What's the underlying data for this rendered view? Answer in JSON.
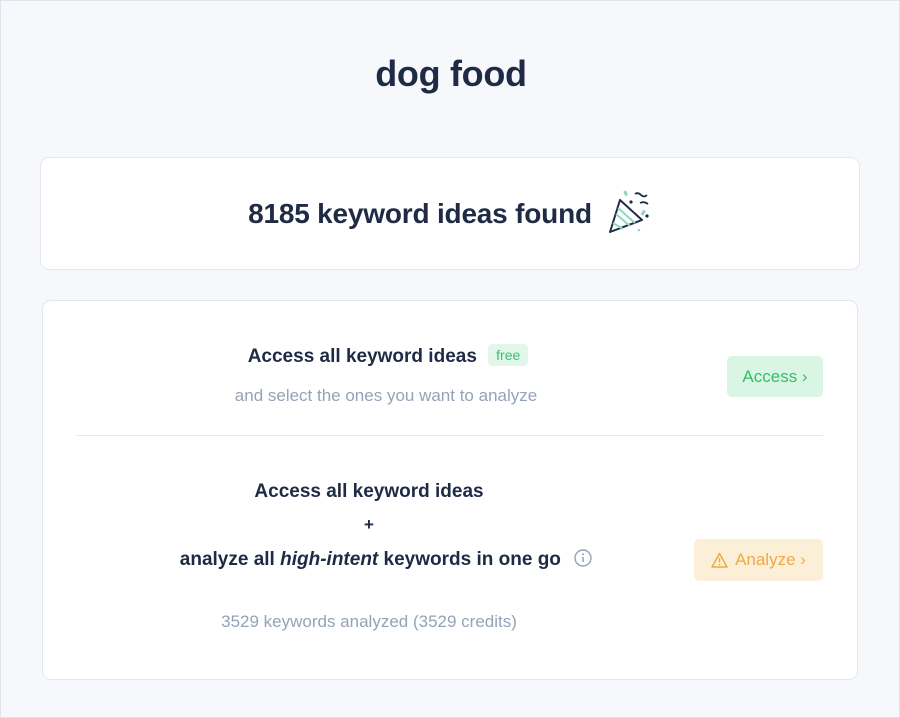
{
  "page": {
    "title": "dog food"
  },
  "results": {
    "found_text": "8185 keyword ideas found",
    "icon": "party-popper-icon"
  },
  "access_option": {
    "title": "Access all keyword ideas",
    "badge": "free",
    "subtitle": "and select the ones you want to analyze",
    "button_label": "Access ›"
  },
  "analyze_option": {
    "line1": "Access all keyword ideas",
    "plus": "+",
    "line3_prefix": "analyze all ",
    "line3_emphasis": "high-intent",
    "line3_suffix": " keywords in one go",
    "info_icon": "info-icon",
    "button_icon": "warning-icon",
    "button_label": "Analyze ›",
    "credits_text": "3529 keywords analyzed (3529 credits)"
  },
  "colors": {
    "background": "#f6f8fb",
    "heading": "#1f2b45",
    "muted": "#94a3b8",
    "success_bg": "#d9f5e3",
    "success_text": "#37bd6e",
    "warning_bg": "#fcefd8",
    "warning_text": "#f2a845"
  }
}
